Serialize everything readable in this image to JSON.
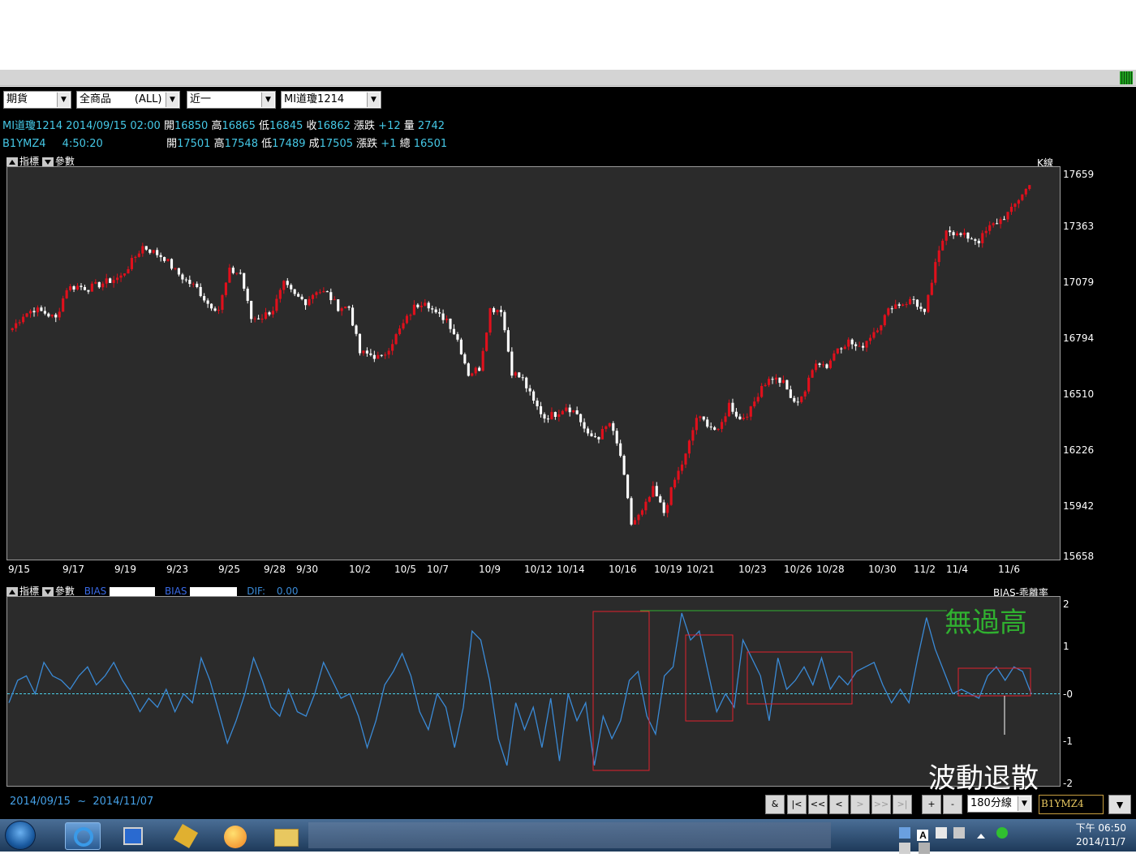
{
  "toolbar": {
    "market": "期貨",
    "product": "全商品       (ALL)",
    "period": "近一",
    "symbol": "MI道瓊1214"
  },
  "quote1": {
    "name": "MI道瓊1214",
    "datetime": "2014/09/15 02:00",
    "open_label": "開",
    "open": "16850",
    "high_label": "高",
    "high": "16865",
    "low_label": "低",
    "low": "16845",
    "close_label": "收",
    "close": "16862",
    "change_label": "漲跌",
    "change": "+12",
    "vol_label": "量",
    "vol": "2742"
  },
  "quote2": {
    "name": "B1YMZ4",
    "time": "4:50:20",
    "open_label": "開",
    "open": "17501",
    "high_label": "高",
    "high": "17548",
    "low_label": "低",
    "low": "17489",
    "last_label": "成",
    "last": "17505",
    "change_label": "漲跌",
    "change": "+1",
    "total_label": "總",
    "total": "16501"
  },
  "kpanel": {
    "indicator_label": "指標",
    "param_label": "參數",
    "type_label": "K線"
  },
  "bpanel": {
    "indicator_label": "指標",
    "param_label": "參數",
    "bias1_label": "BIAS",
    "bias2_label": "BIAS",
    "dif_label": "DIF:",
    "dif_value": "0.00",
    "type_label": "BIAS-乖離率"
  },
  "annotations": {
    "top": "無過高",
    "bottom": "波動退散"
  },
  "footer": {
    "date_from": "2014/09/15",
    "tilde": "~",
    "date_to": "2014/11/07",
    "nav": [
      "&",
      "|<",
      "<<",
      "<",
      ">",
      ">>",
      ">|",
      "+",
      "-"
    ],
    "interval": "180分線",
    "symbol": "B1YMZ4"
  },
  "taskbar": {
    "clock_time": "下午 06:50",
    "clock_date": "2014/11/7"
  },
  "colors": {
    "up": "#e0101c",
    "down": "#ffffff",
    "bias_line": "#3a8ad6",
    "zero_line": "#4ad0e8",
    "box": "#e0202c",
    "annot_green": "#30b030",
    "annot_white": "#ffffff"
  },
  "chart_data": [
    {
      "type": "candlestick",
      "title": "K線",
      "ylim": [
        15658,
        17659
      ],
      "y_ticks": [
        "17659",
        "17363",
        "17079",
        "16794",
        "16510",
        "16226",
        "15942",
        "15658"
      ],
      "x_ticks": [
        "9/15",
        "9/17",
        "9/19",
        "9/23",
        "9/25",
        "9/28",
        "9/30",
        "10/2",
        "10/5",
        "10/7",
        "10/9",
        "10/12",
        "10/14",
        "10/16",
        "10/19",
        "10/21",
        "10/23",
        "10/26",
        "10/28",
        "10/30",
        "11/2",
        "11/4",
        "11/6"
      ],
      "close_path": [
        16850,
        16920,
        16950,
        16930,
        16900,
        17060,
        17070,
        17060,
        17080,
        17100,
        17120,
        17200,
        17280,
        17250,
        17220,
        17150,
        17100,
        17060,
        16980,
        16950,
        17150,
        17140,
        16900,
        16910,
        16950,
        17080,
        17020,
        16990,
        17050,
        17030,
        16960,
        16960,
        16720,
        16710,
        16690,
        16780,
        16870,
        16960,
        17000,
        16920,
        16900,
        16790,
        16610,
        16640,
        16950,
        16950,
        16620,
        16580,
        16460,
        16380,
        16400,
        16440,
        16400,
        16280,
        16280,
        16350,
        16180,
        15820,
        15880,
        16000,
        15880,
        16050,
        16180,
        16380,
        16350,
        16300,
        16450,
        16370,
        16420,
        16550,
        16590,
        16560,
        16450,
        16520,
        16680,
        16650,
        16750,
        16780,
        16740,
        16810,
        16880,
        16970,
        16980,
        17000,
        16920,
        17180,
        17380,
        17340,
        17330,
        17310,
        17380,
        17420,
        17470,
        17560,
        17620
      ]
    },
    {
      "type": "line",
      "title": "BIAS-乖離率",
      "ylim": [
        -2,
        2
      ],
      "y_ticks": [
        "2",
        "1",
        "-0",
        "-1",
        "-2"
      ],
      "values": [
        -0.2,
        0.3,
        0.4,
        0.0,
        0.7,
        0.4,
        0.3,
        0.1,
        0.4,
        0.6,
        0.2,
        0.4,
        0.7,
        0.3,
        0.0,
        -0.4,
        -0.1,
        -0.3,
        0.1,
        -0.4,
        0.0,
        -0.2,
        0.8,
        0.3,
        -0.4,
        -1.1,
        -0.6,
        0.0,
        0.8,
        0.3,
        -0.3,
        -0.5,
        0.1,
        -0.4,
        -0.5,
        0.0,
        0.7,
        0.3,
        -0.1,
        0.0,
        -0.5,
        -1.2,
        -0.6,
        0.2,
        0.5,
        0.9,
        0.4,
        -0.4,
        -0.8,
        0.0,
        -0.3,
        -1.2,
        -0.3,
        1.4,
        1.2,
        0.3,
        -1.0,
        -1.6,
        -0.2,
        -0.8,
        -0.3,
        -1.2,
        -0.1,
        -1.5,
        0.0,
        -0.6,
        -0.2,
        -1.6,
        -0.5,
        -1.0,
        -0.6,
        0.3,
        0.5,
        -0.5,
        -0.9,
        0.4,
        0.6,
        1.8,
        1.2,
        1.4,
        0.5,
        -0.4,
        0.0,
        -0.3,
        1.2,
        0.8,
        0.4,
        -0.6,
        0.8,
        0.1,
        0.3,
        0.6,
        0.2,
        0.8,
        0.1,
        0.4,
        0.2,
        0.5,
        0.6,
        0.7,
        0.2,
        -0.2,
        0.1,
        -0.2,
        0.8,
        1.7,
        1.0,
        0.5,
        0.0,
        0.1,
        0.0,
        -0.1,
        0.4,
        0.6,
        0.3,
        0.6,
        0.5,
        0.0
      ]
    }
  ]
}
